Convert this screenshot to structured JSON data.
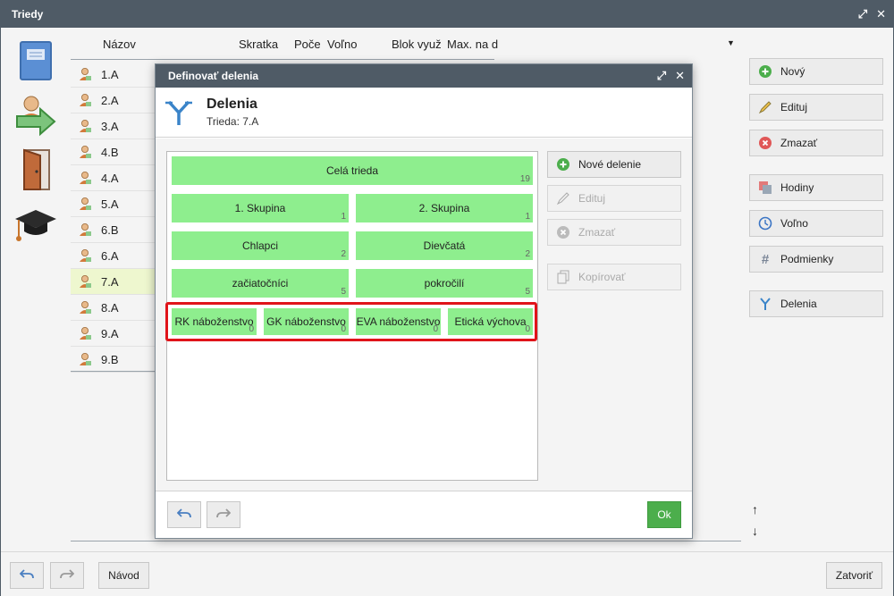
{
  "window": {
    "title": "Triedy"
  },
  "grid": {
    "headers": [
      "Názov",
      "Skratka",
      "Poče",
      "Voľno",
      "Blok využ",
      "Max. na d"
    ],
    "rows": [
      "1.A",
      "2.A",
      "3.A",
      "4.B",
      "4.A",
      "5.A",
      "6.B",
      "6.A",
      "7.A",
      "8.A",
      "9.A",
      "9.B"
    ],
    "selected_index": 8
  },
  "sidebar": {
    "novy": "Nový",
    "edituj": "Edituj",
    "zmazat": "Zmazať",
    "hodiny": "Hodiny",
    "volno": "Voľno",
    "podmienky": "Podmienky",
    "delenia": "Delenia"
  },
  "bottom": {
    "navod": "Návod",
    "zatvorit": "Zatvoriť"
  },
  "dialog": {
    "title": "Definovať delenia",
    "heading": "Delenia",
    "subheading": "Trieda: 7.A",
    "tiles": {
      "cela": {
        "label": "Celá trieda",
        "count": "19"
      },
      "s1": {
        "label": "1. Skupina",
        "count": "1"
      },
      "s2": {
        "label": "2. Skupina",
        "count": "1"
      },
      "chlapci": {
        "label": "Chlapci",
        "count": "2"
      },
      "dievcata": {
        "label": "Dievčatá",
        "count": "2"
      },
      "zac": {
        "label": "začiatočníci",
        "count": "5"
      },
      "pok": {
        "label": "pokročilí",
        "count": "5"
      },
      "rk": {
        "label": "RK náboženstvo",
        "count": "0"
      },
      "gk": {
        "label": "GK náboženstvo",
        "count": "0"
      },
      "eva": {
        "label": "EVA náboženstvo",
        "count": "0"
      },
      "et": {
        "label": "Etická výchova",
        "count": "0"
      }
    },
    "actions": {
      "nove": "Nové delenie",
      "edituj": "Edituj",
      "zmazat": "Zmazať",
      "kopirovat": "Kopírovať"
    },
    "ok": "Ok"
  },
  "colors": {
    "titlebar": "#4f5b66",
    "tile": "#8eee8e",
    "highlight": "#e0141a",
    "ok": "#4cae4c",
    "selected_row": "#eef7cf"
  }
}
